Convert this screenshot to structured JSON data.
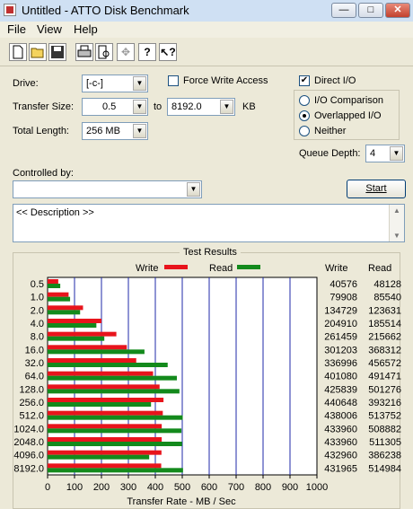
{
  "window": {
    "title": "Untitled - ATTO Disk Benchmark",
    "buttons": {
      "minimize": "—",
      "maximize": "□",
      "close": "✕"
    }
  },
  "menu": {
    "items": [
      "File",
      "View",
      "Help"
    ]
  },
  "toolbar": {
    "icons": [
      "new-document-icon",
      "open-folder-icon",
      "save-icon",
      "print-icon",
      "print-preview-icon",
      "move-icon",
      "help-icon",
      "context-help-icon"
    ]
  },
  "form": {
    "drive_label": "Drive:",
    "drive_value": "[-c-]",
    "force_write_label": "Force Write Access",
    "direct_io_label": "Direct I/O",
    "direct_io_checked": true,
    "transfer_size_label": "Transfer Size:",
    "transfer_from": "0.5",
    "to_label": "to",
    "transfer_to": "8192.0",
    "kb_label": "KB",
    "total_length_label": "Total Length:",
    "total_length_value": "256 MB",
    "io_comparison_label": "I/O Comparison",
    "overlapped_io_label": "Overlapped I/O",
    "neither_label": "Neither",
    "selected_mode": "Overlapped I/O",
    "queue_depth_label": "Queue Depth:",
    "queue_depth_value": "4",
    "controlled_by_label": "Controlled by:",
    "controlled_by_value": "",
    "start_label": "Start",
    "description_text": "<< Description >>"
  },
  "results": {
    "group_title": "Test Results",
    "legend_write": "Write",
    "legend_read": "Read",
    "col_write": "Write",
    "col_read": "Read",
    "colors": {
      "write": "#e8141c",
      "read": "#138a1c",
      "grid": "#1f2aa8"
    }
  },
  "chart_data": {
    "type": "bar",
    "orientation": "horizontal",
    "categories": [
      "0.5",
      "1.0",
      "2.0",
      "4.0",
      "8.0",
      "16.0",
      "32.0",
      "64.0",
      "128.0",
      "256.0",
      "512.0",
      "1024.0",
      "2048.0",
      "4096.0",
      "8192.0"
    ],
    "series": [
      {
        "name": "Write",
        "values": [
          40576,
          79908,
          134729,
          204910,
          261459,
          301203,
          336996,
          401080,
          425839,
          440648,
          438006,
          433960,
          433960,
          432960,
          431965
        ]
      },
      {
        "name": "Read",
        "values": [
          48128,
          85540,
          123631,
          185514,
          215662,
          368312,
          456572,
          491471,
          501276,
          393216,
          513752,
          508882,
          511305,
          386238,
          514984
        ]
      }
    ],
    "xlabel": "Transfer Rate - MB / Sec",
    "xlim": [
      0,
      1000
    ],
    "xticks": [
      0,
      100,
      200,
      300,
      400,
      500,
      600,
      700,
      800,
      900,
      1000
    ],
    "grid": true,
    "legend": "top"
  }
}
